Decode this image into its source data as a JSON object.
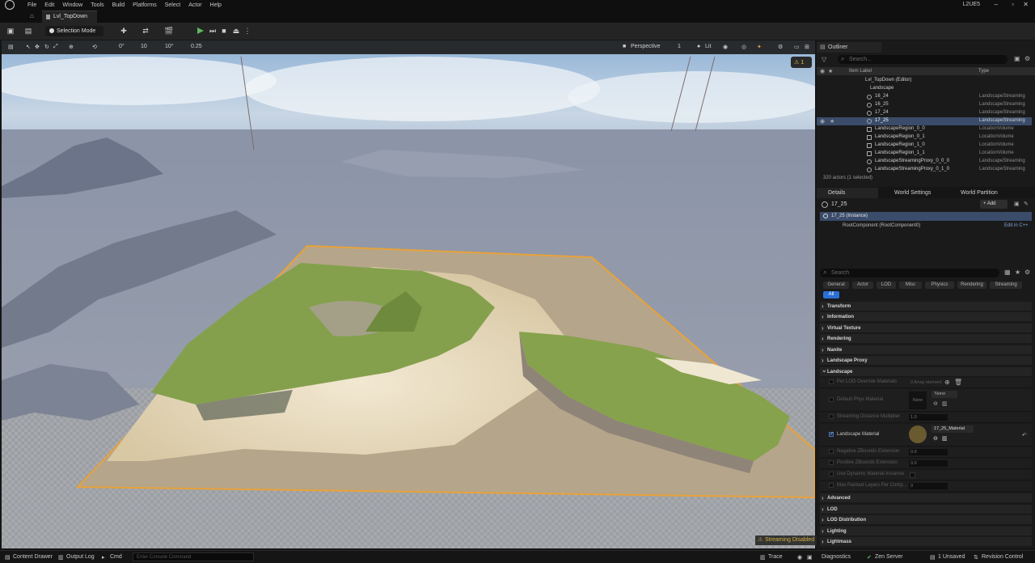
{
  "menu": {
    "items": [
      "File",
      "Edit",
      "Window",
      "Tools",
      "Build",
      "Platforms",
      "Select",
      "Actor",
      "Help"
    ],
    "project": "L2UE5"
  },
  "tab": {
    "label": "Lvl_TopDown"
  },
  "toolbar": {
    "mode_label": "Selection Mode"
  },
  "viewport_toolbar": {
    "grid_move": "0°",
    "grid_snap": "10",
    "rot_snap": "10°",
    "scale_snap": "0.25",
    "view_mode": "Perspective",
    "lit": "Lit",
    "speed": "1",
    "warning_count": "1"
  },
  "viewport": {
    "streaming": "Streaming Disabled"
  },
  "outliner": {
    "tab": "Outliner",
    "search_placeholder": "Search...",
    "col_label": "Item Label",
    "col_type": "Type",
    "rows": [
      {
        "label": "Lvl_TopDown (Editor)",
        "type": ""
      },
      {
        "label": "Landscape",
        "type": ""
      },
      {
        "label": "16_24",
        "type": "LandscapeStreaming"
      },
      {
        "label": "16_25",
        "type": "LandscapeStreaming"
      },
      {
        "label": "17_24",
        "type": "LandscapeStreaming"
      },
      {
        "label": "17_25",
        "type": "LandscapeStreaming"
      },
      {
        "label": "LandscapeRegion_0_0",
        "type": "LocationVolume"
      },
      {
        "label": "LandscapeRegion_0_1",
        "type": "LocationVolume"
      },
      {
        "label": "LandscapeRegion_1_0",
        "type": "LocationVolume"
      },
      {
        "label": "LandscapeRegion_1_1",
        "type": "LocationVolume"
      },
      {
        "label": "LandscapeStreamingProxy_0_0_0",
        "type": "LandscapeStreaming"
      },
      {
        "label": "LandscapeStreamingProxy_0_1_0",
        "type": "LandscapeStreaming"
      }
    ],
    "footer": "320 actors (1 selected)"
  },
  "details": {
    "tabs": [
      "Details",
      "World Settings",
      "World Partition"
    ],
    "actor_name": "17_25",
    "add_label": "+ Add",
    "instance": "17_25 (Instance)",
    "root": "RootComponent (RootComponent0)",
    "edit_cpp": "Edit in C++",
    "search_placeholder": "Search",
    "filters": [
      "General",
      "Actor",
      "LOD",
      "Misc",
      "Physics",
      "Rendering",
      "Streaming"
    ],
    "all_label": "All",
    "sections": [
      "Transform",
      "Information",
      "Virtual Texture",
      "Rendering",
      "Nanite",
      "Landscape Proxy",
      "Landscape"
    ],
    "props": [
      {
        "label": "Per LOD Override Materials",
        "value": "0 Array element"
      },
      {
        "label": "Default Phys Material",
        "value": "None"
      },
      {
        "label": "Streaming Distance Multiplier",
        "value": "1.0"
      },
      {
        "label": "Landscape Material",
        "value": "17_25_Material"
      },
      {
        "label": "Negative ZBounds Extension",
        "value": "0.0"
      },
      {
        "label": "Positive ZBounds Extension",
        "value": "0.0"
      },
      {
        "label": "Use Dynamic Material Instance",
        "value": ""
      },
      {
        "label": "Max Painted Layers Per Comp...",
        "value": "0"
      }
    ],
    "sections_bottom": [
      "Advanced",
      "LOD",
      "LOD Distribution",
      "Lighting",
      "Lightmass"
    ],
    "none_thumb": "None"
  },
  "bottom": {
    "content_drawer": "Content Drawer",
    "output_log": "Output Log",
    "cmd": "Cmd",
    "console_placeholder": "Enter Console Command",
    "trace": "Trace",
    "diagnostics": "Diagnostics",
    "zen": "Zen Server",
    "unsaved": "1 Unsaved",
    "revision": "Revision Control"
  },
  "colors": {
    "selection": "#3a4c6a",
    "accent": "#e8a23a",
    "play": "#5cb85c"
  }
}
